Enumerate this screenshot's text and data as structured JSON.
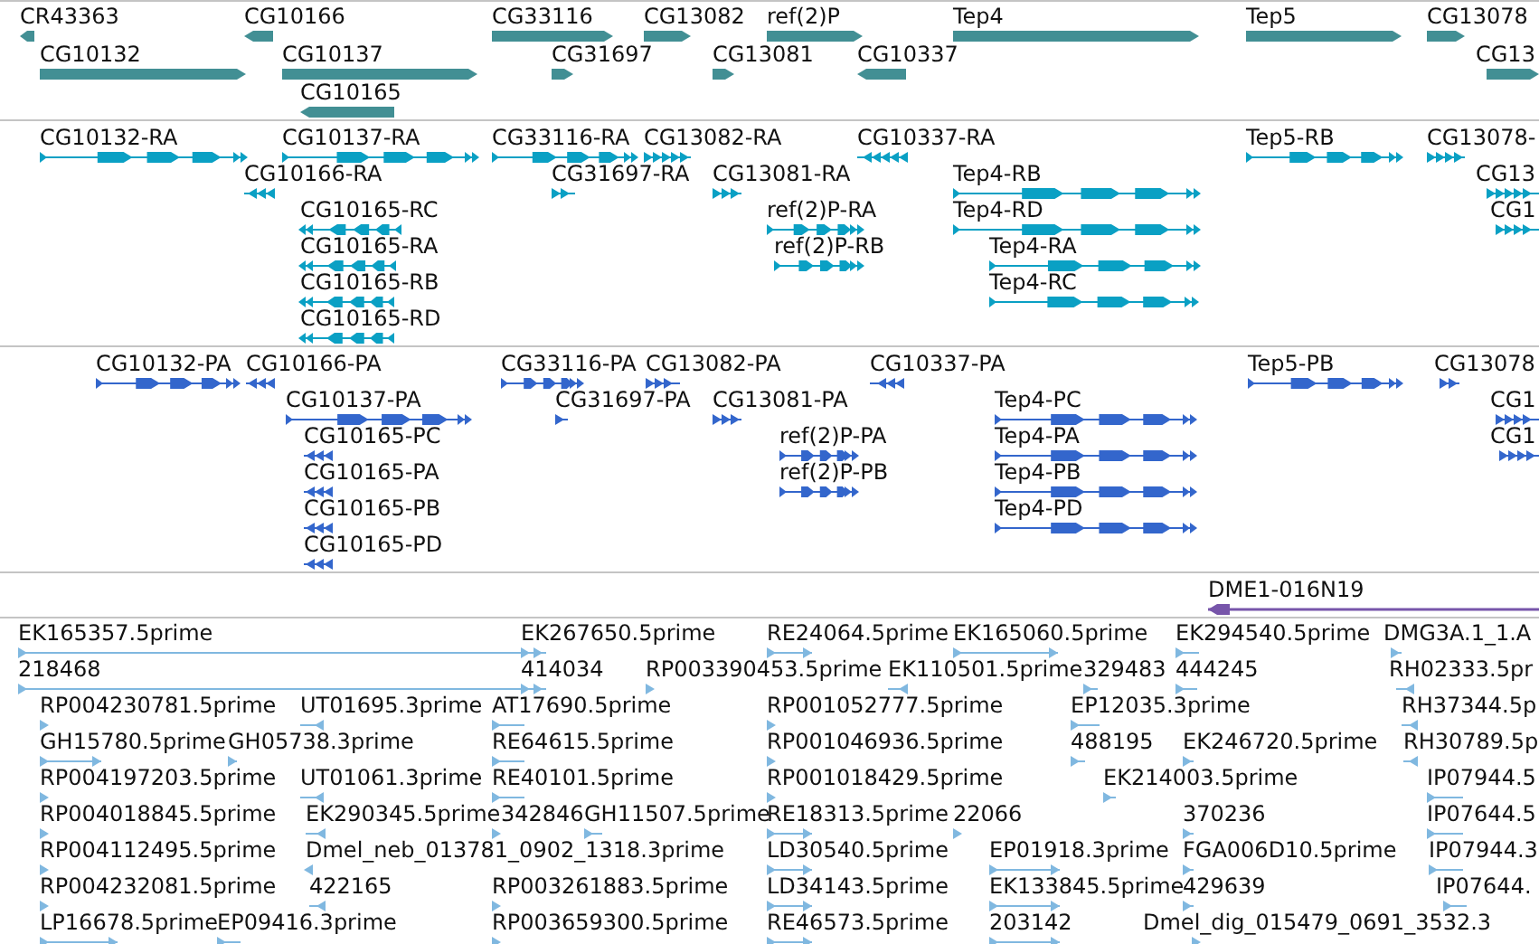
{
  "tracks": [
    {
      "kind": "gene",
      "color": "#428f94",
      "features": [
        {
          "label": "CR43363",
          "reverse": true
        },
        {
          "label": "CG10166",
          "reverse": true
        },
        {
          "label": "CG33116",
          "reverse": false
        },
        {
          "label": "CG13082",
          "reverse": false
        },
        {
          "label": "ref(2)P",
          "reverse": false
        },
        {
          "label": "Tep4",
          "reverse": false
        },
        {
          "label": "Tep5",
          "reverse": false
        },
        {
          "label": "CG13078",
          "reverse": false
        },
        {
          "label": "CG10132",
          "reverse": false
        },
        {
          "label": "CG10137",
          "reverse": false
        },
        {
          "label": "CG31697",
          "reverse": false
        },
        {
          "label": "CG13081",
          "reverse": false
        },
        {
          "label": "CG10337",
          "reverse": true
        },
        {
          "label": "CG13",
          "reverse": false
        },
        {
          "label": "CG10165",
          "reverse": true
        }
      ]
    },
    {
      "kind": "transcript",
      "color": "#0aa0c4",
      "features": [
        {
          "label": "CG10132-RA",
          "reverse": false
        },
        {
          "label": "CG10137-RA",
          "reverse": false
        },
        {
          "label": "CG33116-RA",
          "reverse": false
        },
        {
          "label": "CG13082-RA",
          "reverse": false
        },
        {
          "label": "CG10337-RA",
          "reverse": true
        },
        {
          "label": "Tep5-RB",
          "reverse": false
        },
        {
          "label": "CG13078-",
          "reverse": false
        },
        {
          "label": "CG10166-RA",
          "reverse": true
        },
        {
          "label": "CG31697-RA",
          "reverse": false
        },
        {
          "label": "CG13081-RA",
          "reverse": false
        },
        {
          "label": "Tep4-RB",
          "reverse": false
        },
        {
          "label": "CG13",
          "reverse": false
        },
        {
          "label": "CG10165-RC",
          "reverse": true
        },
        {
          "label": "ref(2)P-RA",
          "reverse": false
        },
        {
          "label": "Tep4-RD",
          "reverse": false
        },
        {
          "label": "CG1",
          "reverse": false
        },
        {
          "label": "CG10165-RA",
          "reverse": true
        },
        {
          "label": "ref(2)P-RB",
          "reverse": false
        },
        {
          "label": "Tep4-RA",
          "reverse": false
        },
        {
          "label": "CG10165-RB",
          "reverse": true
        },
        {
          "label": "Tep4-RC",
          "reverse": false
        },
        {
          "label": "CG10165-RD",
          "reverse": true
        }
      ]
    },
    {
      "kind": "protein",
      "color": "#3366cc",
      "features": [
        {
          "label": "CG10132-PA",
          "reverse": false
        },
        {
          "label": "CG10166-PA",
          "reverse": true
        },
        {
          "label": "CG33116-PA",
          "reverse": false
        },
        {
          "label": "CG13082-PA",
          "reverse": false
        },
        {
          "label": "CG10337-PA",
          "reverse": true
        },
        {
          "label": "Tep5-PB",
          "reverse": false
        },
        {
          "label": "CG13078",
          "reverse": false
        },
        {
          "label": "CG10137-PA",
          "reverse": false
        },
        {
          "label": "CG31697-PA",
          "reverse": false
        },
        {
          "label": "CG13081-PA",
          "reverse": false
        },
        {
          "label": "Tep4-PC",
          "reverse": false
        },
        {
          "label": "CG1",
          "reverse": false
        },
        {
          "label": "CG10165-PC",
          "reverse": true
        },
        {
          "label": "ref(2)P-PA",
          "reverse": false
        },
        {
          "label": "Tep4-PA",
          "reverse": false
        },
        {
          "label": "CG1",
          "reverse": false
        },
        {
          "label": "CG10165-PA",
          "reverse": true
        },
        {
          "label": "ref(2)P-PB",
          "reverse": false
        },
        {
          "label": "Tep4-PB",
          "reverse": false
        },
        {
          "label": "CG10165-PB",
          "reverse": true
        },
        {
          "label": "Tep4-PD",
          "reverse": false
        },
        {
          "label": "CG10165-PD",
          "reverse": true
        }
      ]
    },
    {
      "kind": "clone",
      "color": "#7755aa",
      "features": [
        {
          "label": "DME1-016N19",
          "reverse": true
        }
      ]
    },
    {
      "kind": "est",
      "color": "#80b8e0",
      "features": [
        {
          "label": "EK165357.5prime",
          "reverse": false
        },
        {
          "label": "EK267650.5prime",
          "reverse": false
        },
        {
          "label": "RE24064.5prime",
          "reverse": false
        },
        {
          "label": "EK165060.5prime",
          "reverse": false
        },
        {
          "label": "EK294540.5prime",
          "reverse": false
        },
        {
          "label": "DMG3A.1_1.A",
          "reverse": false
        },
        {
          "label": "218468",
          "reverse": false
        },
        {
          "label": "414034",
          "reverse": false
        },
        {
          "label": "RP003390453.5prime",
          "reverse": false
        },
        {
          "label": "EK110501.5prime",
          "reverse": true
        },
        {
          "label": "329483",
          "reverse": false
        },
        {
          "label": "444245",
          "reverse": false
        },
        {
          "label": "RH02333.5pr",
          "reverse": true
        },
        {
          "label": "RP004230781.5prime",
          "reverse": false
        },
        {
          "label": "UT01695.3prime",
          "reverse": true
        },
        {
          "label": "AT17690.5prime",
          "reverse": false
        },
        {
          "label": "RP001052777.5prime",
          "reverse": false
        },
        {
          "label": "EP12035.3prime",
          "reverse": false
        },
        {
          "label": "RH37344.5p",
          "reverse": true
        },
        {
          "label": "GH15780.5prime",
          "reverse": false
        },
        {
          "label": "GH05738.3prime",
          "reverse": false
        },
        {
          "label": "RE64615.5prime",
          "reverse": false
        },
        {
          "label": "RP001046936.5prime",
          "reverse": false
        },
        {
          "label": "488195",
          "reverse": false
        },
        {
          "label": "EK246720.5prime",
          "reverse": false
        },
        {
          "label": "RH30789.5p",
          "reverse": true
        },
        {
          "label": "RP004197203.5prime",
          "reverse": false
        },
        {
          "label": "UT01061.3prime",
          "reverse": true
        },
        {
          "label": "RE40101.5prime",
          "reverse": false
        },
        {
          "label": "RP001018429.5prime",
          "reverse": false
        },
        {
          "label": "EK214003.5prime",
          "reverse": false
        },
        {
          "label": "IP07944.5",
          "reverse": false
        },
        {
          "label": "RP004018845.5prime",
          "reverse": false
        },
        {
          "label": "EK290345.5prime",
          "reverse": true
        },
        {
          "label": "342846",
          "reverse": false
        },
        {
          "label": "GH11507.5prime",
          "reverse": false
        },
        {
          "label": "RE18313.5prime",
          "reverse": false
        },
        {
          "label": "22066",
          "reverse": false
        },
        {
          "label": "370236",
          "reverse": false
        },
        {
          "label": "IP07644.5",
          "reverse": false
        },
        {
          "label": "RP004112495.5prime",
          "reverse": false
        },
        {
          "label": "Dmel_neb_013781_0902_1318.3prime",
          "reverse": true
        },
        {
          "label": "LD30540.5prime",
          "reverse": false
        },
        {
          "label": "EP01918.3prime",
          "reverse": false
        },
        {
          "label": "FGA006D10.5prime",
          "reverse": false
        },
        {
          "label": "IP07944.3",
          "reverse": false
        },
        {
          "label": "RP004232081.5prime",
          "reverse": false
        },
        {
          "label": "422165",
          "reverse": true
        },
        {
          "label": "RP003261883.5prime",
          "reverse": false
        },
        {
          "label": "LD34143.5prime",
          "reverse": false
        },
        {
          "label": "EK133845.5prime",
          "reverse": false
        },
        {
          "label": "429639",
          "reverse": false
        },
        {
          "label": "IP07644.",
          "reverse": false
        },
        {
          "label": "LP16678.5prime",
          "reverse": false
        },
        {
          "label": "EP09416.3prime",
          "reverse": false
        },
        {
          "label": "RP003659300.5prime",
          "reverse": false
        },
        {
          "label": "RE46573.5prime",
          "reverse": false
        },
        {
          "label": "203142",
          "reverse": false
        },
        {
          "label": "Dmel_dig_015479_0691_3532.3",
          "reverse": false
        }
      ]
    }
  ]
}
